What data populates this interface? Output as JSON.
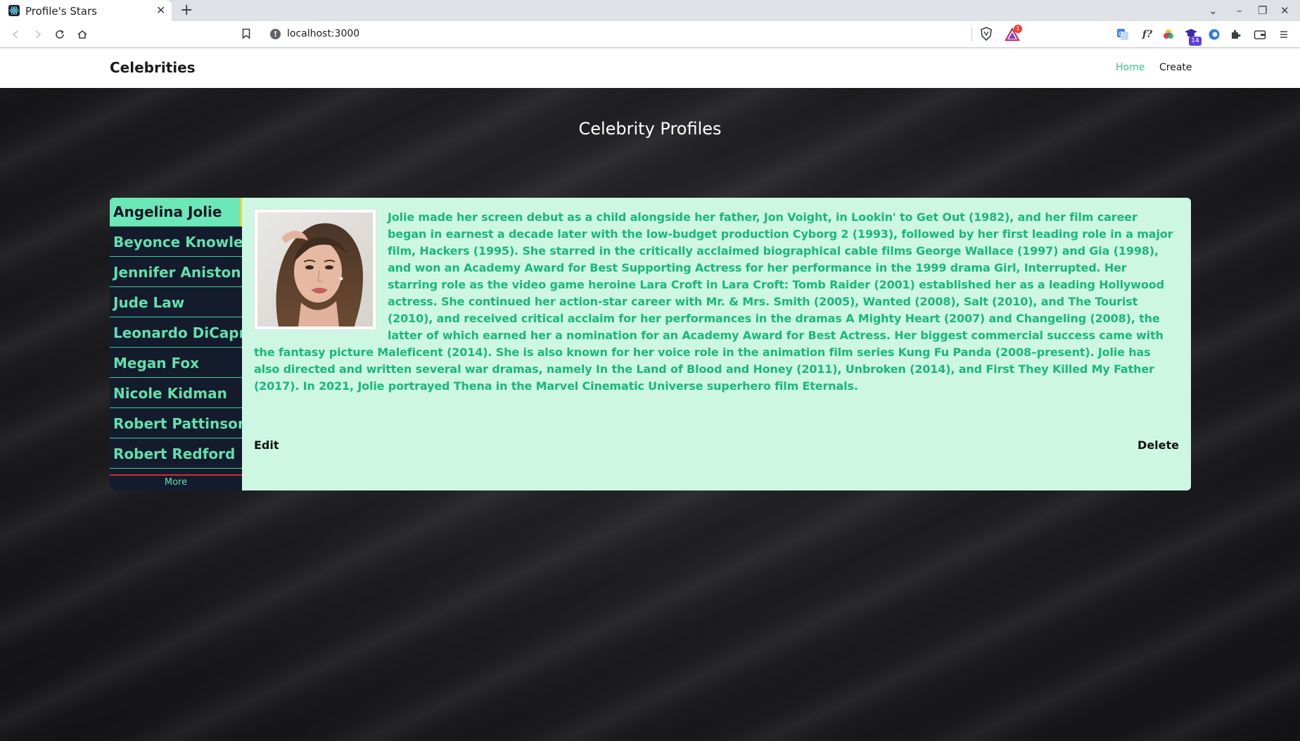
{
  "browser": {
    "tab_title": "Profile's Stars",
    "tab_close": "✕",
    "new_tab": "+",
    "url": "localhost:3000",
    "window_controls": {
      "chevron": "⌄",
      "minimize": "–",
      "restore": "❐",
      "close": "✕"
    },
    "ext_badge": "14",
    "rewards_badge": "1"
  },
  "nav": {
    "brand": "Celebrities",
    "links": [
      {
        "label": "Home",
        "active": true
      },
      {
        "label": "Create",
        "active": false
      }
    ]
  },
  "page": {
    "heading": "Celebrity Profiles"
  },
  "sidebar": {
    "items": [
      {
        "label": "Angelina Jolie",
        "active": true
      },
      {
        "label": "Beyonce Knowles"
      },
      {
        "label": "Jennifer Aniston"
      },
      {
        "label": "Jude Law"
      },
      {
        "label": "Leonardo DiCaprio"
      },
      {
        "label": "Megan Fox"
      },
      {
        "label": "Nicole Kidman"
      },
      {
        "label": "Robert Pattinson"
      },
      {
        "label": "Robert Redford"
      }
    ],
    "more_label": "More"
  },
  "profile": {
    "bio": "Jolie made her screen debut as a child alongside her father, Jon Voight, in Lookin' to Get Out (1982), and her film career began in earnest a decade later with the low-budget production Cyborg 2 (1993), followed by her first leading role in a major film, Hackers (1995). She starred in the critically acclaimed biographical cable films George Wallace (1997) and Gia (1998), and won an Academy Award for Best Supporting Actress for her performance in the 1999 drama Girl, Interrupted. Her starring role as the video game heroine Lara Croft in Lara Croft: Tomb Raider (2001) established her as a leading Hollywood actress. She continued her action-star career with Mr. & Mrs. Smith (2005), Wanted (2008), Salt (2010), and The Tourist (2010), and received critical acclaim for her performances in the dramas A Mighty Heart (2007) and Changeling (2008), the latter of which earned her a nomination for an Academy Award for Best Actress. Her biggest commercial success came with the fantasy picture Maleficent (2014). She is also known for her voice role in the animation film series Kung Fu Panda (2008–present). Jolie has also directed and written several war dramas, namely In the Land of Blood and Honey (2011), Unbroken (2014), and First They Killed My Father (2017). In 2021, Jolie portrayed Thena in the Marvel Cinematic Universe superhero film Eternals.",
    "edit_label": "Edit",
    "delete_label": "Delete"
  },
  "colors": {
    "accent": "#38c787",
    "card_bg": "#cdf7e3",
    "sidebar_bg": "#141b2d",
    "sidebar_active": "#6ce8b8",
    "bio_text": "#19b87b"
  }
}
